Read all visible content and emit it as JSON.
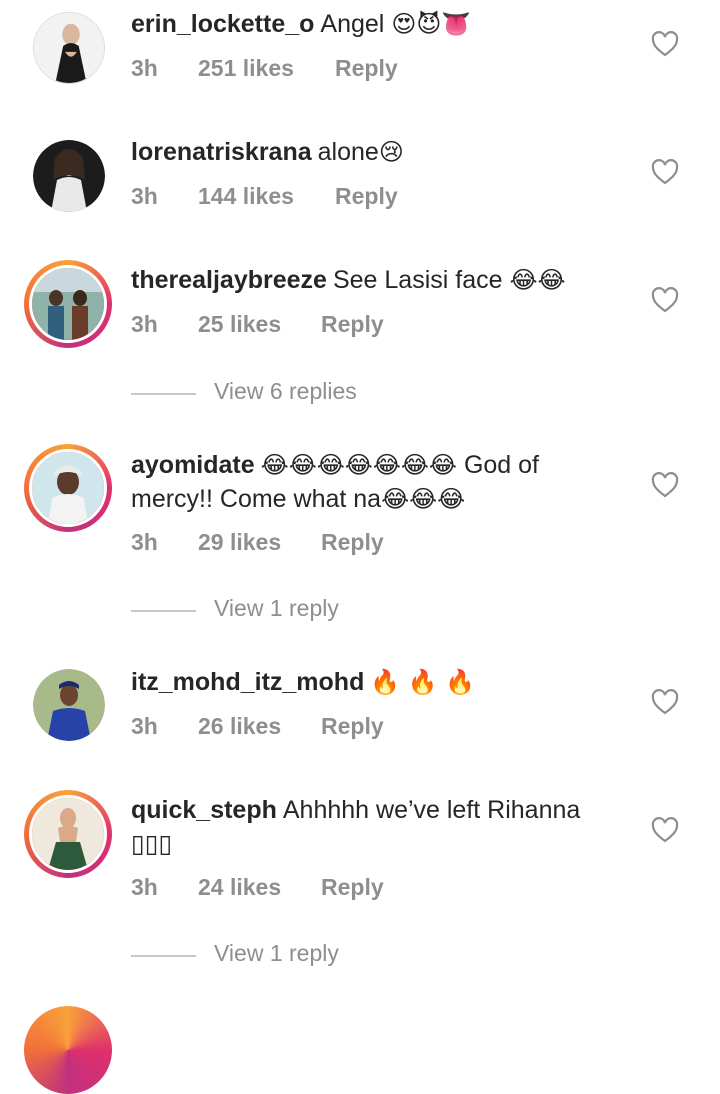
{
  "comments": [
    {
      "username": "erin_lockette_o",
      "text": "Angel",
      "emoji": "😍😈👅",
      "time": "3h",
      "likes": "251 likes",
      "reply": "Reply"
    },
    {
      "username": "lorenatriskrana",
      "text": "alone",
      "emoji": "😢",
      "time": "3h",
      "likes": "144 likes",
      "reply": "Reply"
    },
    {
      "username": "therealjaybreeze",
      "text": "See Lasisi face",
      "emoji": "😂😂",
      "time": "3h",
      "likes": "25 likes",
      "reply": "Reply"
    },
    {
      "username": "ayomidate",
      "text_emoji_1": "😂😂😂😂😂😂😂",
      "text": "God of",
      "text_line2": "mercy!! Come what na",
      "emoji": "😂😂😂",
      "time": "3h",
      "likes": "29 likes",
      "reply": "Reply"
    },
    {
      "username": "itz_mohd_itz_mohd",
      "text": "",
      "emoji": "🔥 🔥 🔥",
      "time": "3h",
      "likes": "26 likes",
      "reply": "Reply"
    },
    {
      "username": "quick_steph",
      "text": "Ahhhhh we’ve left Rihanna",
      "text_line2": "▯▯▯",
      "time": "3h",
      "likes": "24 likes",
      "reply": "Reply"
    }
  ],
  "view_replies": [
    "View 6 replies",
    "View 1 reply",
    "View 1 reply"
  ],
  "colors": {
    "muted": "#8e8e8e",
    "text": "#262626",
    "ring": "#e0306c"
  }
}
